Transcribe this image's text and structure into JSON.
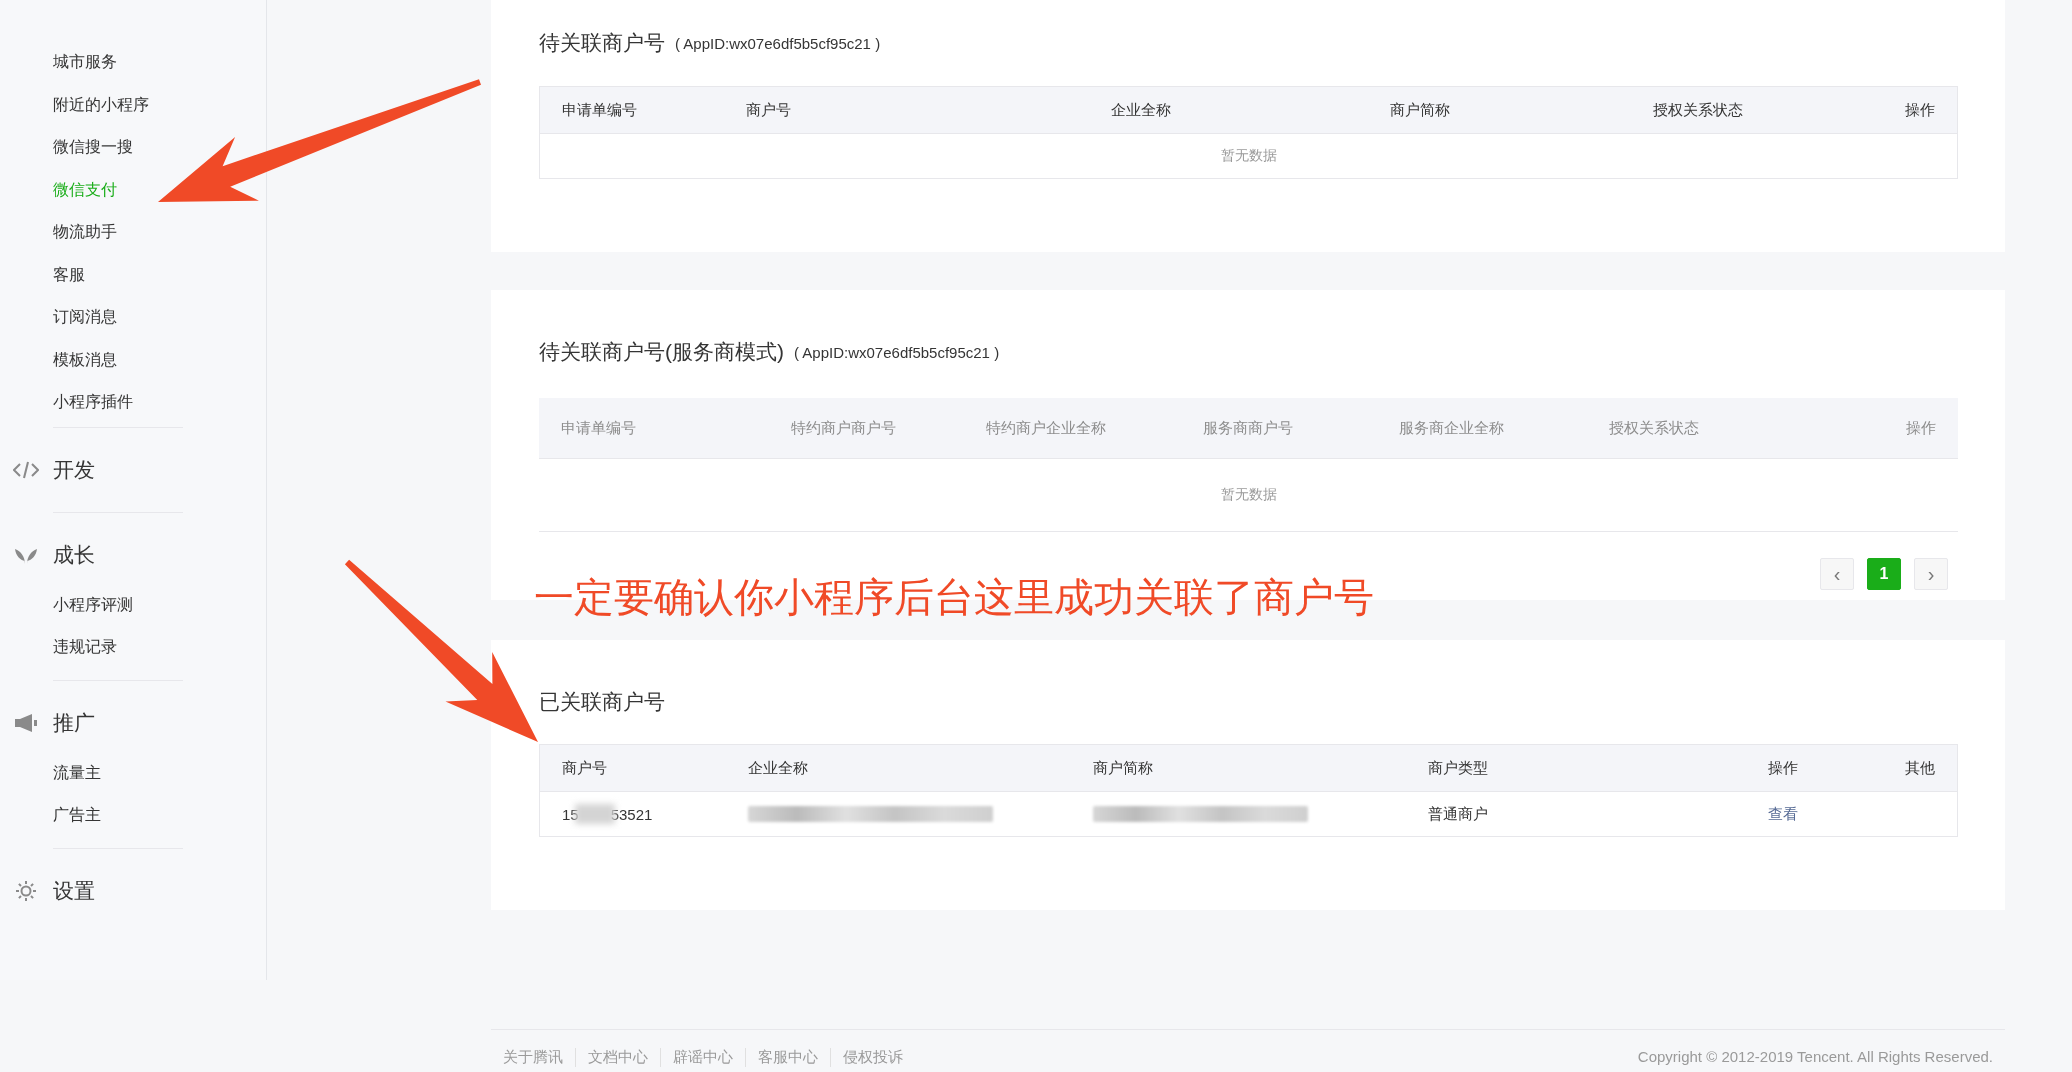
{
  "sidebar": {
    "groups": [
      {
        "items": [
          {
            "label": "城市服务",
            "selected": false
          },
          {
            "label": "附近的小程序",
            "selected": false
          },
          {
            "label": "微信搜一搜",
            "selected": false
          },
          {
            "label": "微信支付",
            "selected": true
          },
          {
            "label": "物流助手",
            "selected": false
          },
          {
            "label": "客服",
            "selected": false
          },
          {
            "label": "订阅消息",
            "selected": false
          },
          {
            "label": "模板消息",
            "selected": false
          },
          {
            "label": "小程序插件",
            "selected": false
          }
        ]
      },
      {
        "title": "开发"
      },
      {
        "title": "成长",
        "items": [
          {
            "label": "小程序评测",
            "selected": false
          },
          {
            "label": "违规记录",
            "selected": false
          }
        ]
      },
      {
        "title": "推广",
        "items": [
          {
            "label": "流量主",
            "selected": false
          },
          {
            "label": "广告主",
            "selected": false
          }
        ]
      },
      {
        "title": "设置"
      }
    ]
  },
  "cards": [
    {
      "title": "待关联商户号",
      "appid": "( AppID:wx07e6df5b5cf95c21 )",
      "table": {
        "columns": [
          "申请单编号",
          "商户号",
          "企业全称",
          "商户简称",
          "授权关系状态",
          "操作"
        ],
        "empty_text": "暂无数据"
      }
    },
    {
      "title": "待关联商户号(服务商模式)",
      "appid": "( AppID:wx07e6df5b5cf95c21 )",
      "table": {
        "columns": [
          "申请单编号",
          "特约商户商户号",
          "特约商户企业全称",
          "服务商商户号",
          "服务商企业全称",
          "授权关系状态",
          "操作"
        ],
        "empty_text": "暂无数据"
      },
      "pagination": [
        {
          "label": "‹",
          "disabled": true,
          "selected": false
        },
        {
          "label": "1",
          "disabled": false,
          "selected": true
        },
        {
          "label": "›",
          "disabled": true,
          "selected": false
        }
      ]
    },
    {
      "title": "已关联商户号",
      "table": {
        "columns": [
          "商户号",
          "企业全称",
          "商户简称",
          "商户类型",
          "操作",
          "其他"
        ],
        "rows": [
          [
            {
              "kind": "masked",
              "parts": [
                "15",
                "53521"
              ]
            },
            {
              "kind": "redacted"
            },
            {
              "kind": "redacted"
            },
            {
              "kind": "text",
              "text": "普通商户"
            },
            {
              "kind": "link",
              "text": "查看"
            },
            {
              "kind": "empty"
            }
          ]
        ]
      }
    }
  ],
  "annotation": {
    "note": "一定要确认你小程序后台这里成功关联了商户号"
  },
  "footer": {
    "links": [
      "关于腾讯",
      "文档中心",
      "辟谣中心",
      "客服中心",
      "侵权投诉"
    ],
    "copyright": "Copyright © 2012-2019 Tencent. All Rights Reserved."
  }
}
